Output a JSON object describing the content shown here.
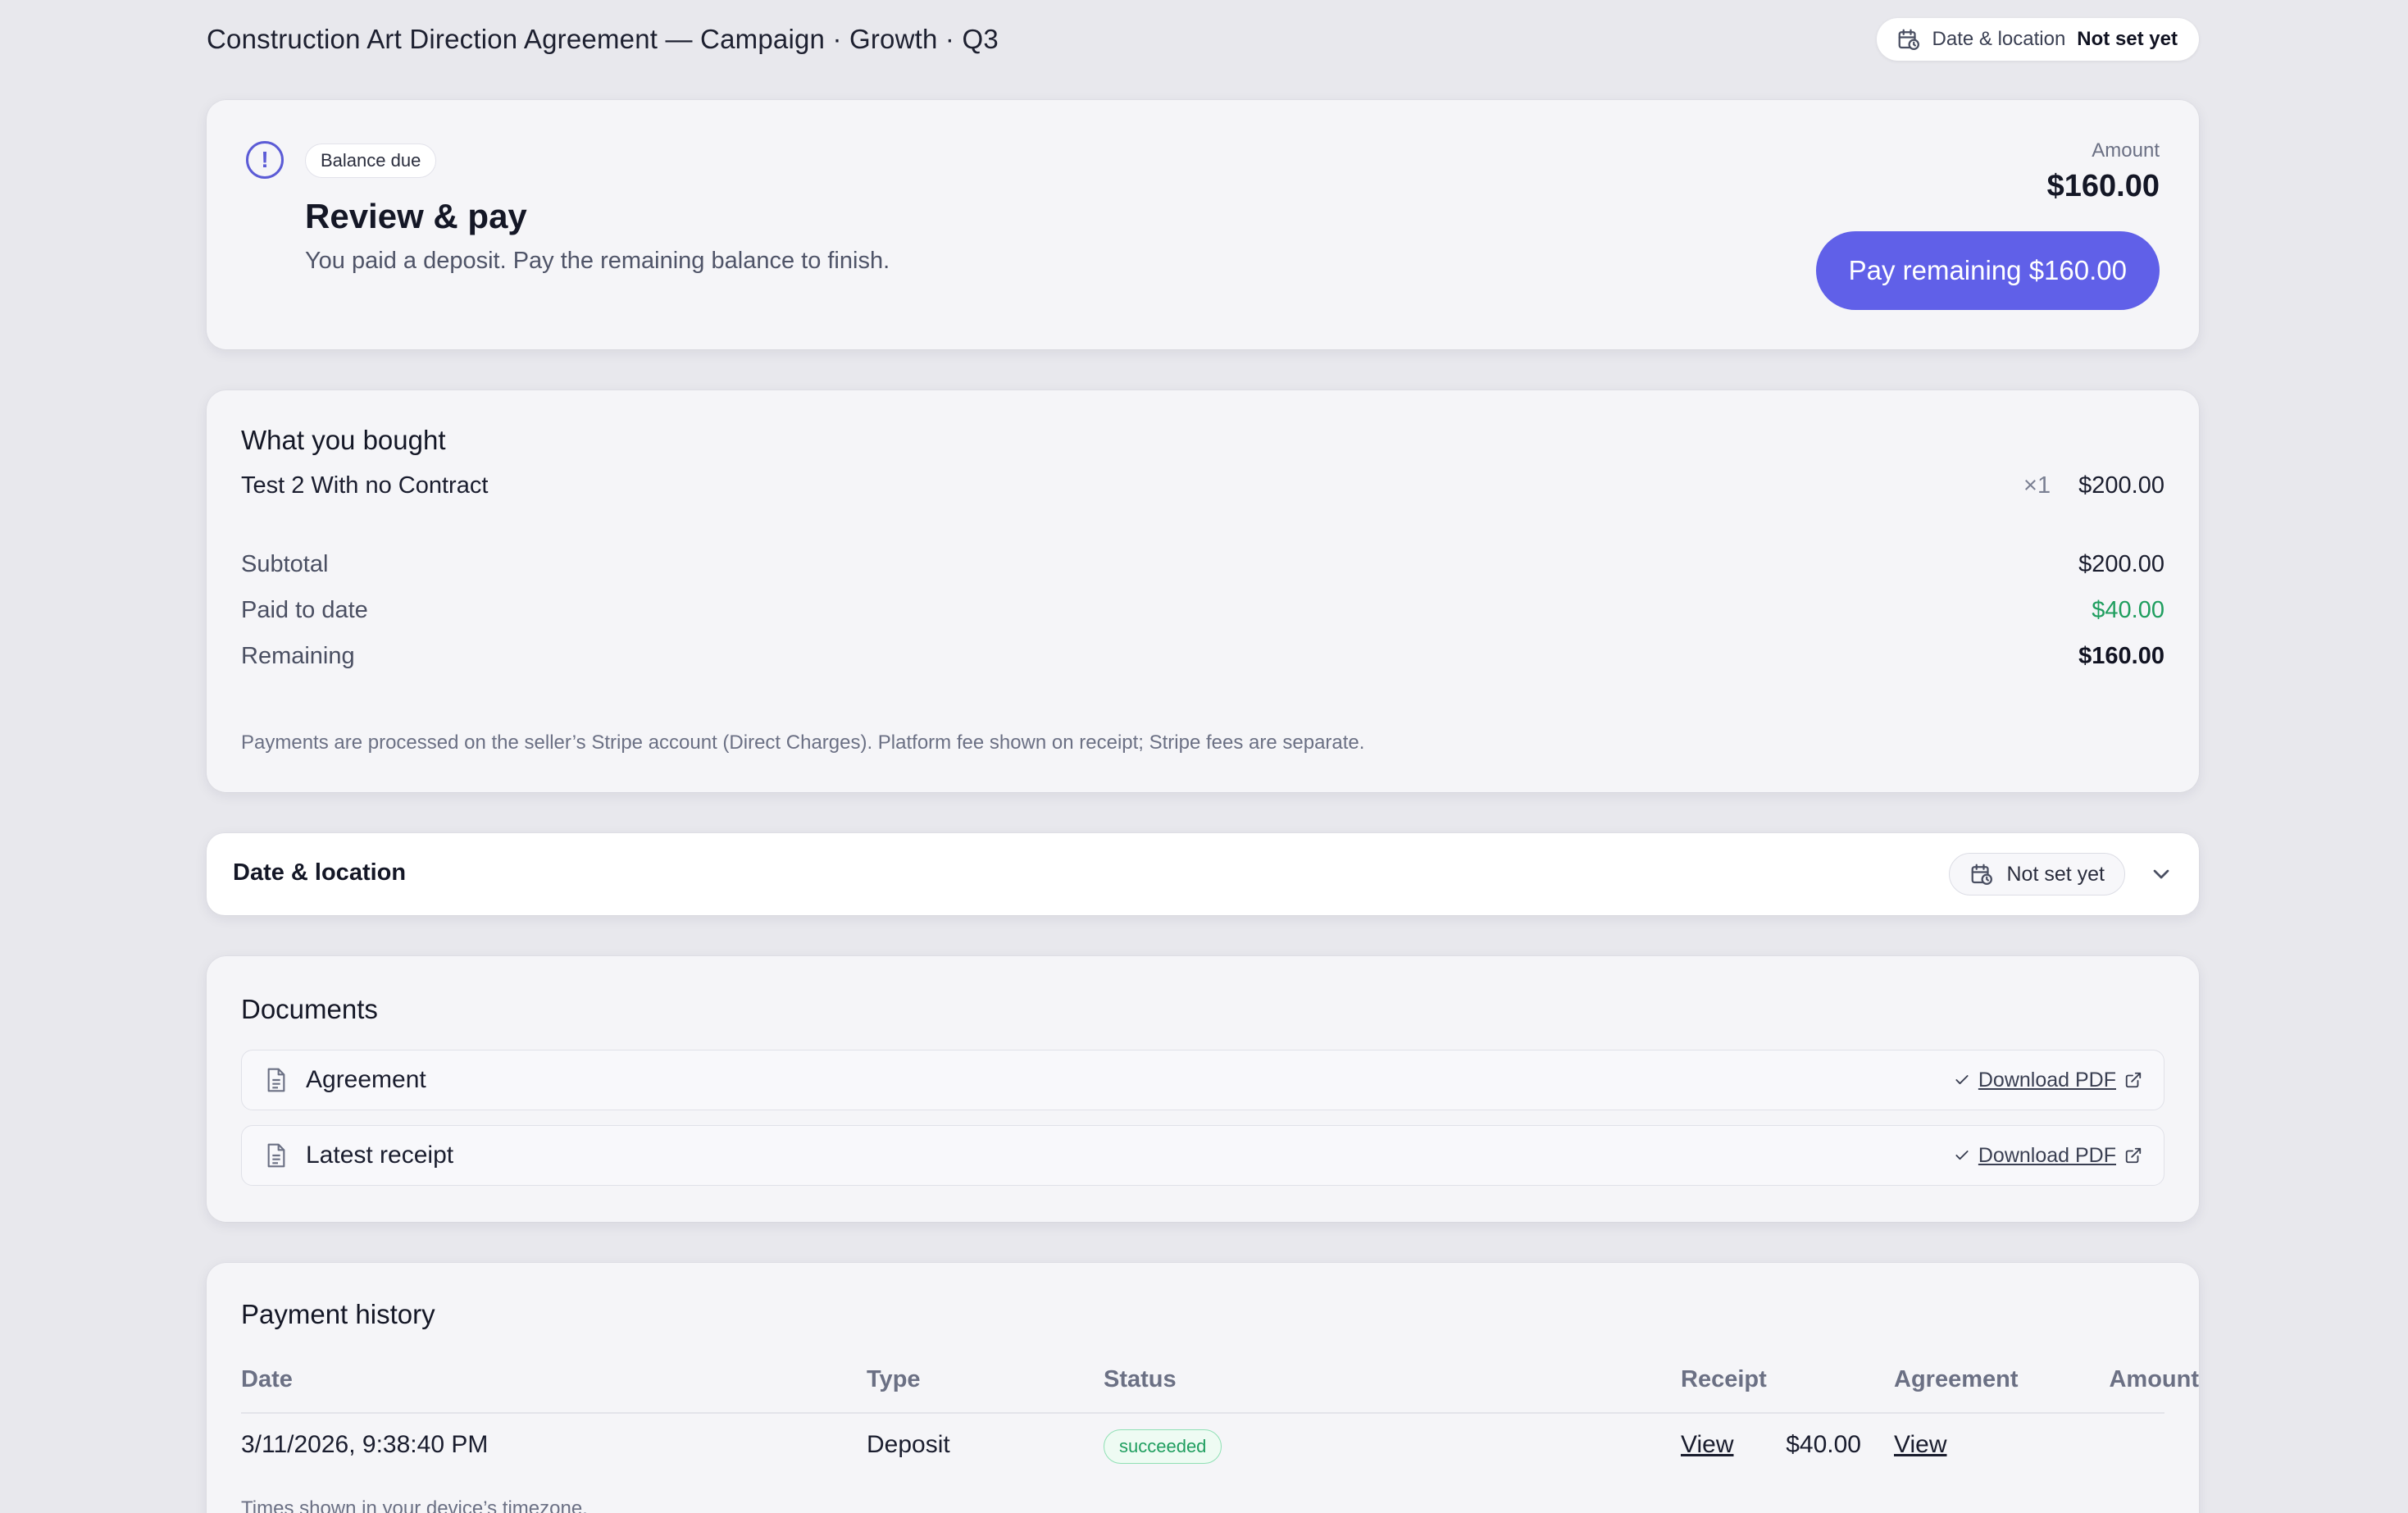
{
  "header": {
    "title": "Construction Art Direction Agreement — Campaign · Growth · Q3",
    "chip_label": "Date & location",
    "chip_value": "Not set yet"
  },
  "review": {
    "badge": "Balance due",
    "title": "Review & pay",
    "subtitle": "You paid a deposit. Pay the remaining balance to finish.",
    "amount_label": "Amount",
    "amount_value": "$160.00",
    "pay_button": "Pay remaining $160.00",
    "accent_color": "#6060e8"
  },
  "bought": {
    "heading": "What you bought",
    "item": {
      "name": "Test 2 With no Contract",
      "qty": "×1",
      "price": "$200.00"
    },
    "subtotal_label": "Subtotal",
    "subtotal_value": "$200.00",
    "paid_label": "Paid to date",
    "paid_value": "$40.00",
    "remaining_label": "Remaining",
    "remaining_value": "$160.00",
    "note": "Payments are processed on the seller’s Stripe account (Direct Charges). Platform fee shown on receipt; Stripe fees are separate."
  },
  "date_location": {
    "title": "Date & location",
    "status": "Not set yet"
  },
  "documents": {
    "heading": "Documents",
    "items": [
      {
        "name": "Agreement",
        "action": "Download PDF"
      },
      {
        "name": "Latest receipt",
        "action": "Download PDF"
      }
    ]
  },
  "history": {
    "heading": "Payment history",
    "columns": [
      "Date",
      "Type",
      "Status",
      "Amount",
      "Receipt",
      "Agreement"
    ],
    "rows": [
      {
        "date": "3/11/2026, 9:38:40 PM",
        "type": "Deposit",
        "status": "succeeded",
        "amount": "$40.00",
        "receipt": "View",
        "agreement": "View"
      }
    ],
    "footnote": "Times shown in your device’s timezone."
  }
}
